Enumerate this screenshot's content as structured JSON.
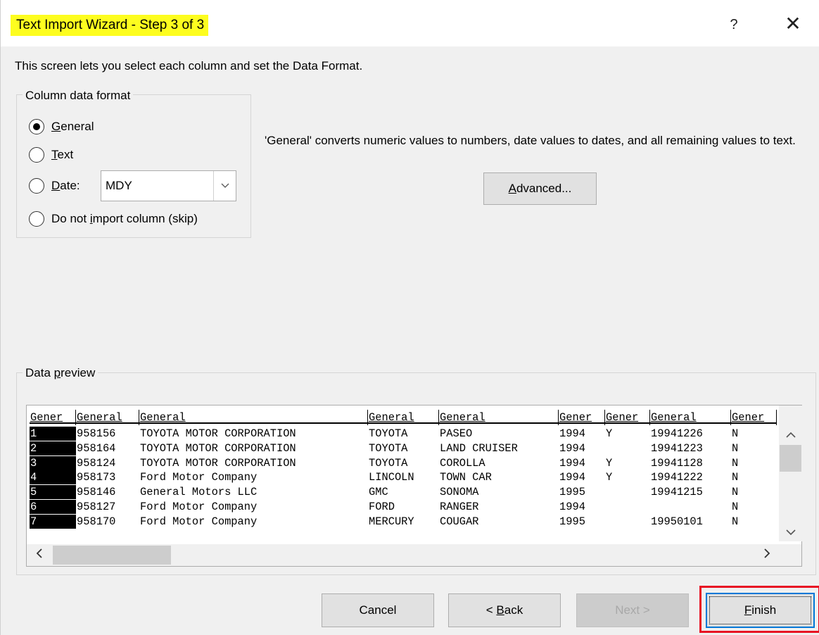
{
  "window": {
    "title": "Text Import Wizard - Step 3 of 3",
    "help_glyph": "?",
    "close_glyph": "✕"
  },
  "intro_text": "This screen lets you select each column and set the Data Format.",
  "column_format": {
    "legend": "Column data format",
    "options": [
      {
        "accel": "G",
        "rest": "eneral",
        "prefix": "",
        "checked": true
      },
      {
        "accel": "T",
        "rest": "ext",
        "prefix": "",
        "checked": false
      },
      {
        "accel": "D",
        "rest": "ate:",
        "prefix": "",
        "checked": false
      },
      {
        "prefix": "Do not ",
        "accel": "i",
        "rest": "mport column (skip)",
        "checked": false
      }
    ],
    "date_combo": {
      "value": "MDY",
      "arrow_icon": "chevron-down"
    }
  },
  "description": "'General' converts numeric values to numbers, date values to dates, and all remaining values to text.",
  "advanced_button": {
    "accel": "A",
    "rest": "dvanced..."
  },
  "data_preview": {
    "legend_prefix": "Data ",
    "legend_accel": "p",
    "legend_rest": "review",
    "headers": [
      "Gener",
      "General",
      "General",
      "General",
      "General",
      "Gener",
      "Gener",
      "General",
      "Gener"
    ],
    "rows": [
      [
        "1",
        "958156",
        "TOYOTA MOTOR CORPORATION",
        "TOYOTA",
        "PASEO",
        "1994",
        "Y",
        "19941226",
        "N"
      ],
      [
        "2",
        "958164",
        "TOYOTA MOTOR CORPORATION",
        "TOYOTA",
        "LAND CRUISER",
        "1994",
        "",
        "19941223",
        "N"
      ],
      [
        "3",
        "958124",
        "TOYOTA MOTOR CORPORATION",
        "TOYOTA",
        "COROLLA",
        "1994",
        "Y",
        "19941128",
        "N"
      ],
      [
        "4",
        "958173",
        "Ford Motor Company",
        "LINCOLN",
        "TOWN CAR",
        "1994",
        "Y",
        "19941222",
        "N"
      ],
      [
        "5",
        "958146",
        "General Motors LLC",
        "GMC",
        "SONOMA",
        "1995",
        "",
        "19941215",
        "N"
      ],
      [
        "6",
        "958127",
        "Ford Motor Company",
        "FORD",
        "RANGER",
        "1994",
        "",
        "",
        "N"
      ],
      [
        "7",
        "958170",
        "Ford Motor Company",
        "MERCURY",
        "COUGAR",
        "1995",
        "",
        "19950101",
        "N"
      ]
    ]
  },
  "buttons": {
    "cancel": "Cancel",
    "back_prefix": "< ",
    "back_accel": "B",
    "back_rest": "ack",
    "next": "Next >",
    "finish_accel": "F",
    "finish_rest": "inish"
  },
  "colors": {
    "title_highlight": "#fdfd1f",
    "finish_highlight": "#e81123",
    "focus_border": "#0078d7"
  }
}
